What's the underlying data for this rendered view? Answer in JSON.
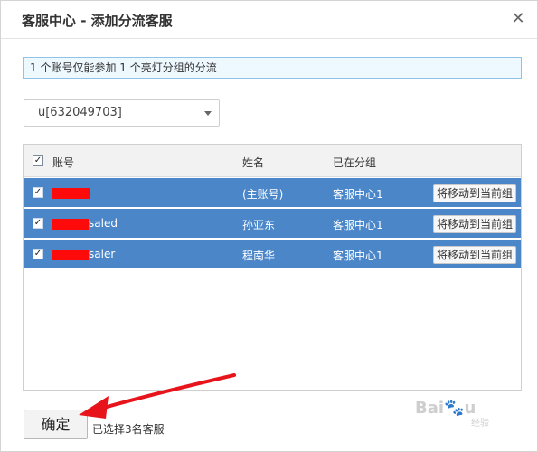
{
  "dialog": {
    "title": "客服中心 - 添加分流客服",
    "close_glyph": "✕"
  },
  "notice": {
    "text": "1 个账号仅能参加 1 个亮灯分组的分流"
  },
  "account_select": {
    "value": "u[632049703]"
  },
  "table": {
    "columns": {
      "account": "账号",
      "name": "姓名",
      "group": "已在分组"
    },
    "header_checked": true,
    "rows": [
      {
        "checked": true,
        "account_suffix": "",
        "name": "(主账号)",
        "group": "客服中心1",
        "action": "将移动到当前组"
      },
      {
        "checked": true,
        "account_suffix": "saled",
        "name": "孙亚东",
        "group": "客服中心1",
        "action": "将移动到当前组"
      },
      {
        "checked": true,
        "account_suffix": "saler",
        "name": "程南华",
        "group": "客服中心1",
        "action": "将移动到当前组"
      }
    ]
  },
  "footer": {
    "confirm_label": "确定",
    "selected_text": "已选择3名客服"
  },
  "watermark": {
    "brand": "Bai",
    "sub": "经验"
  },
  "colors": {
    "row_highlight": "#4a86c8",
    "notice_bg": "#eef8ff",
    "annotation_arrow": "#e8141b",
    "redaction": "#ff0a0a"
  },
  "icons": {
    "close": "close-icon",
    "dropdown": "chevron-down-icon",
    "checkbox": "checkbox-checked-icon"
  }
}
